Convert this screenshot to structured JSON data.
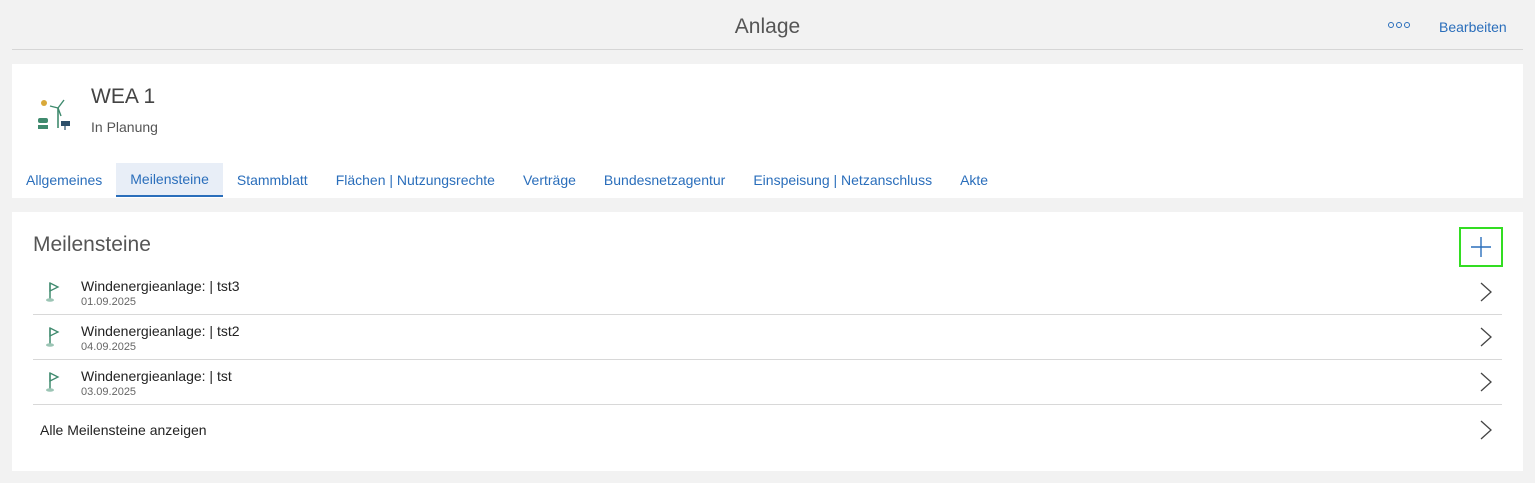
{
  "topbar": {
    "title": "Anlage",
    "edit_label": "Bearbeiten"
  },
  "entity": {
    "name": "WEA 1",
    "status": "In Planung",
    "icon": "wind-solar-plant-icon"
  },
  "tabs": [
    {
      "label": "Allgemeines"
    },
    {
      "label": "Meilensteine",
      "active": true
    },
    {
      "label": "Stammblatt"
    },
    {
      "label": "Flächen | Nutzungsrechte"
    },
    {
      "label": "Verträge"
    },
    {
      "label": "Bundesnetzagentur"
    },
    {
      "label": "Einspeisung | Netzanschluss"
    },
    {
      "label": "Akte"
    }
  ],
  "milestones": {
    "title": "Meilensteine",
    "items": [
      {
        "title": "Windenergieanlage: | tst3",
        "date": "01.09.2025"
      },
      {
        "title": "Windenergieanlage: | tst2",
        "date": "04.09.2025"
      },
      {
        "title": "Windenergieanlage: | tst",
        "date": "03.09.2025"
      }
    ],
    "show_all_label": "Alle Meilensteine anzeigen"
  },
  "colors": {
    "accent": "#2a6ebb",
    "highlight": "#33dd22",
    "icon_green": "#3f8a6e"
  }
}
